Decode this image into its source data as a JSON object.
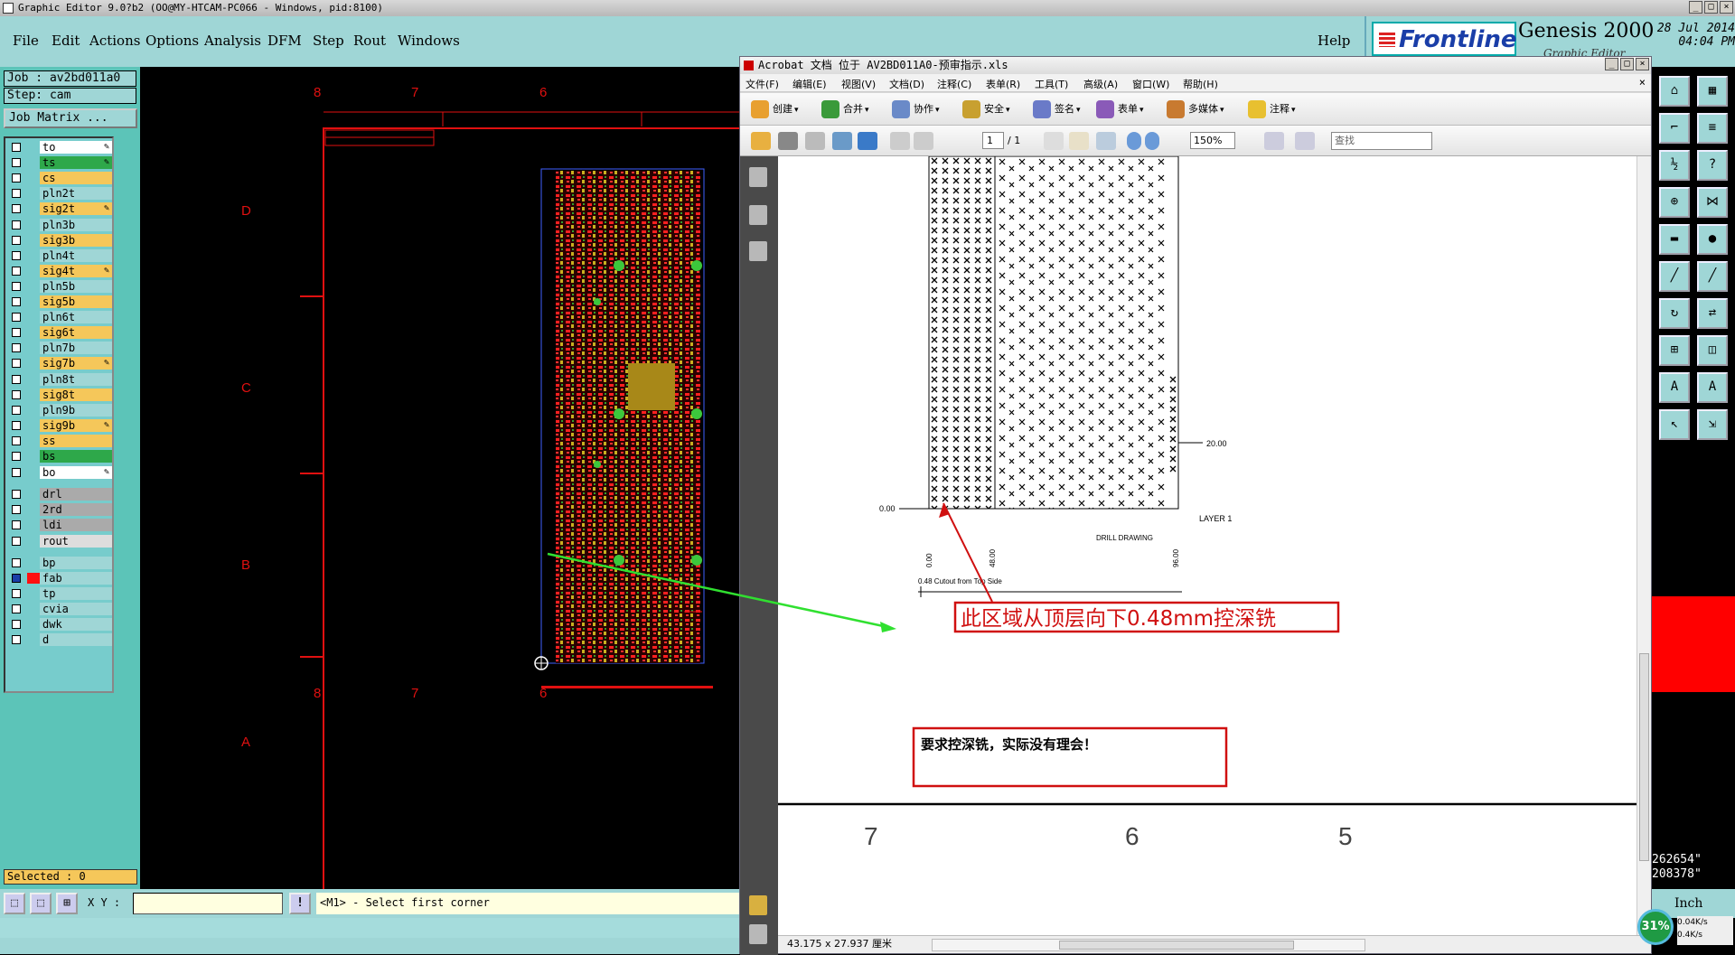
{
  "genesis": {
    "window_title": "Graphic Editor 9.0?b2 (OO@MY-HTCAM-PC066 - Windows, pid:8100)",
    "menu": [
      {
        "label": "File"
      },
      {
        "label": "Edit"
      },
      {
        "label": "Actions"
      },
      {
        "label": "Options"
      },
      {
        "label": "Analysis"
      },
      {
        "label": "DFM"
      },
      {
        "label": "Step"
      },
      {
        "label": "Rout"
      },
      {
        "label": "Windows"
      }
    ],
    "help_label": "Help",
    "brand": {
      "logo_text": "Frontline",
      "product": "Genesis 2000",
      "subtitle": "Graphic Editor",
      "date": "28 Jul 2014",
      "time": "04:04 PM"
    },
    "job_label": "Job : av2bd011a0",
    "step_label": "Step: cam",
    "job_matrix_label": "Job Matrix ...",
    "layers": [
      {
        "name": "to",
        "color": "#ffffff",
        "swatch": "#7cc",
        "editable": true
      },
      {
        "name": "ts",
        "color": "#2ea84a",
        "swatch": "#7cc",
        "editable": true
      },
      {
        "name": "cs",
        "color": "#f5c75a",
        "swatch": "#7cc",
        "editable": false
      },
      {
        "name": "pln2t",
        "color": "#9fd6d6",
        "swatch": "#7cc",
        "editable": false
      },
      {
        "name": "sig2t",
        "color": "#f5c75a",
        "swatch": "#7cc",
        "editable": true
      },
      {
        "name": "pln3b",
        "color": "#9fd6d6",
        "swatch": "#7cc",
        "editable": false
      },
      {
        "name": "sig3b",
        "color": "#f5c75a",
        "swatch": "#7cc",
        "editable": false
      },
      {
        "name": "pln4t",
        "color": "#9fd6d6",
        "swatch": "#7cc",
        "editable": false
      },
      {
        "name": "sig4t",
        "color": "#f5c75a",
        "swatch": "#7cc",
        "editable": true
      },
      {
        "name": "pln5b",
        "color": "#9fd6d6",
        "swatch": "#7cc",
        "editable": false
      },
      {
        "name": "sig5b",
        "color": "#f5c75a",
        "swatch": "#7cc",
        "editable": false
      },
      {
        "name": "pln6t",
        "color": "#9fd6d6",
        "swatch": "#7cc",
        "editable": false
      },
      {
        "name": "sig6t",
        "color": "#f5c75a",
        "swatch": "#7cc",
        "editable": false
      },
      {
        "name": "pln7b",
        "color": "#9fd6d6",
        "swatch": "#7cc",
        "editable": false
      },
      {
        "name": "sig7b",
        "color": "#f5c75a",
        "swatch": "#7cc",
        "editable": true
      },
      {
        "name": "pln8t",
        "color": "#9fd6d6",
        "swatch": "#7cc",
        "editable": false
      },
      {
        "name": "sig8t",
        "color": "#f5c75a",
        "swatch": "#7cc",
        "editable": false
      },
      {
        "name": "pln9b",
        "color": "#9fd6d6",
        "swatch": "#7cc",
        "editable": false
      },
      {
        "name": "sig9b",
        "color": "#f5c75a",
        "swatch": "#7cc",
        "editable": true
      },
      {
        "name": "ss",
        "color": "#f5c75a",
        "swatch": "#7cc",
        "editable": false
      },
      {
        "name": "bs",
        "color": "#2ea84a",
        "swatch": "#7cc",
        "editable": false
      },
      {
        "name": "bo",
        "color": "#ffffff",
        "swatch": "#7cc",
        "editable": true
      },
      {
        "name": "drl",
        "color": "#aaaaaa",
        "swatch": "#7cc",
        "editable": false
      },
      {
        "name": "2rd",
        "color": "#aaaaaa",
        "swatch": "#7cc",
        "editable": false
      },
      {
        "name": "ldi",
        "color": "#aaaaaa",
        "swatch": "#7cc",
        "editable": false
      },
      {
        "name": "rout",
        "color": "#dddddd",
        "swatch": "#7cc",
        "editable": false
      },
      {
        "name": "bp",
        "color": "#9fd6d6",
        "swatch": "#7cc",
        "editable": false
      },
      {
        "name": "fab",
        "color": "#9fd6d6",
        "swatch": "#ff1010",
        "editable": false,
        "selected": true
      },
      {
        "name": "tp",
        "color": "#9fd6d6",
        "swatch": "#7cc",
        "editable": false
      },
      {
        "name": "cvia",
        "color": "#9fd6d6",
        "swatch": "#7cc",
        "editable": false
      },
      {
        "name": "dwk",
        "color": "#9fd6d6",
        "swatch": "#7cc",
        "editable": false
      },
      {
        "name": "d",
        "color": "#9fd6d6",
        "swatch": "#7cc",
        "editable": false
      }
    ],
    "selected_label": "Selected : 0",
    "xy_label": "X Y :",
    "xy_value": "",
    "prompt": "<M1> - Select first corner",
    "drawing_cols": [
      "8",
      "7",
      "6"
    ],
    "drawing_rows": [
      "D",
      "C",
      "B",
      "A"
    ],
    "coords": [
      "262654\"",
      "208378\""
    ],
    "units": "Inch",
    "net_percent": "31%",
    "net_up": "0.04K/s",
    "net_down": "0.4K/s"
  },
  "acrobat": {
    "title": "Acrobat 文档 位于 AV2BD011A0-预审指示.xls",
    "menu": [
      "文件(F)",
      "编辑(E)",
      "视图(V)",
      "文档(D)",
      "注释(C)",
      "表单(R)",
      "工具(T)",
      "高级(A)",
      "窗口(W)",
      "帮助(H)"
    ],
    "toolbar": [
      "创建",
      "合并",
      "协作",
      "安全",
      "签名",
      "表单",
      "多媒体",
      "注释"
    ],
    "page_current": "1",
    "page_count": "/ 1",
    "zoom": "150%",
    "search_placeholder": "查找",
    "page_size": "43.175 x 27.937 厘米",
    "drawing": {
      "dim_right": "20.00",
      "dim_left": "0.00",
      "xdims": [
        "0.00",
        "48.00",
        "96.00"
      ],
      "layer_label": "LAYER 1",
      "drill_label": "DRILL DRAWING",
      "cutout_label": "0.48 Cutout from Top Side",
      "annotation": "此区域从顶层向下0.48mm控深铣",
      "remark": "要求控深铣，实际没有理会！",
      "border_numbers": [
        "7",
        "6",
        "5"
      ]
    }
  }
}
